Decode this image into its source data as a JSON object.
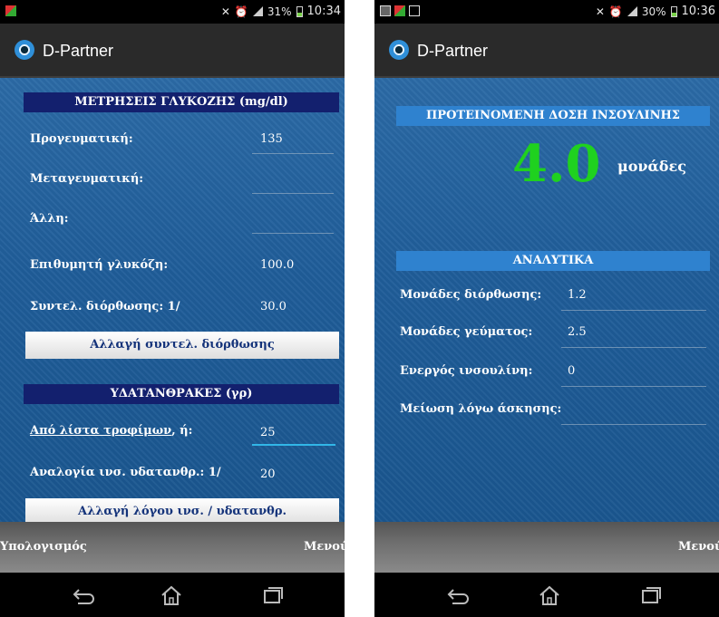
{
  "left_phone": {
    "status": {
      "battery": "31%",
      "time": "10:34"
    },
    "app_title": "D-Partner",
    "glucose_section": {
      "header": "ΜΕΤΡΗΣΕΙΣ ΓΛΥΚΟΖΗΣ (mg/dl)",
      "rows": [
        {
          "label": "Προγευματική:",
          "value": "135"
        },
        {
          "label": "Μεταγευματική:",
          "value": ""
        },
        {
          "label": "Άλλη:",
          "value": ""
        },
        {
          "label": "Επιθυμητή γλυκόζη:",
          "value": "100.0"
        },
        {
          "label": "Συντελ. διόρθωσης: 1/",
          "value": "30.0"
        }
      ],
      "button": "Αλλαγή συντελ. διόρθωσης"
    },
    "carbs_section": {
      "header": "ΥΔΑΤΑΝΘΡΑΚΕΣ (γρ)",
      "food_list_link": "Από λίστα τροφίμων",
      "food_list_suffix": ", ή:",
      "food_list_value": "25",
      "ratio_label": "Αναλογία ινσ. υδατανθρ.: 1/",
      "ratio_value": "20",
      "button": "Αλλαγή λόγου ινσ. / υδατανθρ."
    },
    "bottom": {
      "left": "Υπολογισμός",
      "right": "Μενού"
    }
  },
  "right_phone": {
    "status": {
      "battery": "30%",
      "time": "10:36"
    },
    "app_title": "D-Partner",
    "dose_header": "ΠΡΟΤΕΙΝΟΜΕΝΗ ΔΟΣΗ ΙΝΣΟΥΛΙΝΗΣ",
    "dose_value": "4.0",
    "dose_units": "μονάδες",
    "details_header": "ΑΝΑΛΥΤΙΚΑ",
    "details": [
      {
        "label": "Μονάδες διόρθωσης:",
        "value": "1.2"
      },
      {
        "label": "Μονάδες γεύματος:",
        "value": "2.5"
      },
      {
        "label": "Ενεργός ινσουλίνη:",
        "value": "0"
      },
      {
        "label": "Μείωση λόγω άσκησης:",
        "value": ""
      }
    ],
    "bottom": {
      "right": "Μενού"
    }
  },
  "colors": {
    "dose_value": "#1fd11f",
    "section_header_dark": "#13206e",
    "section_header_light": "#2f82cf",
    "content_blue": "#1f5d99"
  },
  "icons": [
    "status-mute-icon",
    "alarm-icon",
    "signal-icon",
    "battery-icon",
    "back-icon",
    "home-icon",
    "recent-apps-icon",
    "app-logo-icon"
  ]
}
